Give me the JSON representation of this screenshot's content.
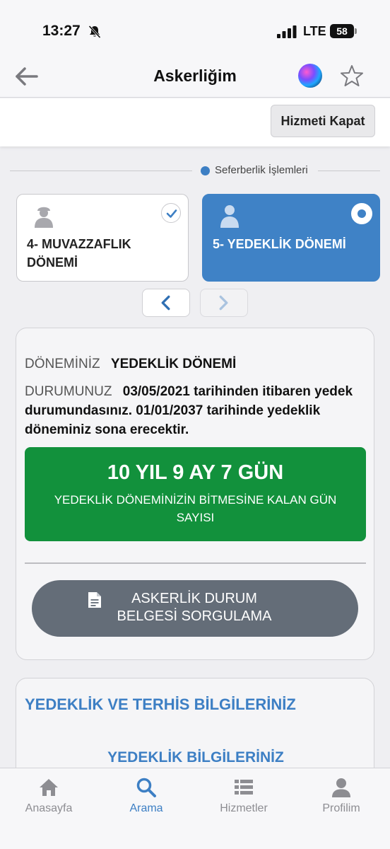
{
  "status_bar": {
    "time": "13:27",
    "network": "LTE",
    "battery": "58",
    "icons": [
      "bell-slash-icon",
      "signal-icon"
    ]
  },
  "nav": {
    "title": "Askerliğim",
    "icons": [
      "back-arrow-icon",
      "siri-icon",
      "star-icon"
    ]
  },
  "actions": {
    "close_service": "Hizmeti Kapat"
  },
  "legend": {
    "label": "Seferberlik İşlemleri",
    "color": "#3d7fc4"
  },
  "periods": [
    {
      "label": "4- MUVAZZAFLIK DÖNEMİ",
      "state": "completed"
    },
    {
      "label": "5- YEDEKLİK DÖNEMİ",
      "state": "selected"
    }
  ],
  "info": {
    "period_key": "DÖNEMİNİZ",
    "period_value": "YEDEKLİK DÖNEMİ",
    "status_key": "DURUMUNUZ",
    "status_value": "03/05/2021 tarihinden itibaren yedek durumundasınız. 01/01/2037 tarihinde yedeklik döneminiz sona erecektir."
  },
  "countdown": {
    "value": "10 YIL 9 AY 7 GÜN",
    "caption": "YEDEKLİK DÖNEMİNİZİN BİTMESİNE KALAN GÜN SAYISI",
    "color": "#12913c"
  },
  "doc_button": {
    "label": "ASKERLİK DURUM BELGESİ SORGULAMA"
  },
  "section": {
    "title": "YEDEKLİK VE TERHİS BİLGİLERİNİZ",
    "subtitle": "YEDEKLİK BİLGİLERİNİZ"
  },
  "tabs": [
    {
      "label": "Anasayfa",
      "icon": "home-icon"
    },
    {
      "label": "Arama",
      "icon": "search-icon",
      "active": true
    },
    {
      "label": "Hizmetler",
      "icon": "list-icon"
    },
    {
      "label": "Profilim",
      "icon": "person-icon"
    }
  ]
}
